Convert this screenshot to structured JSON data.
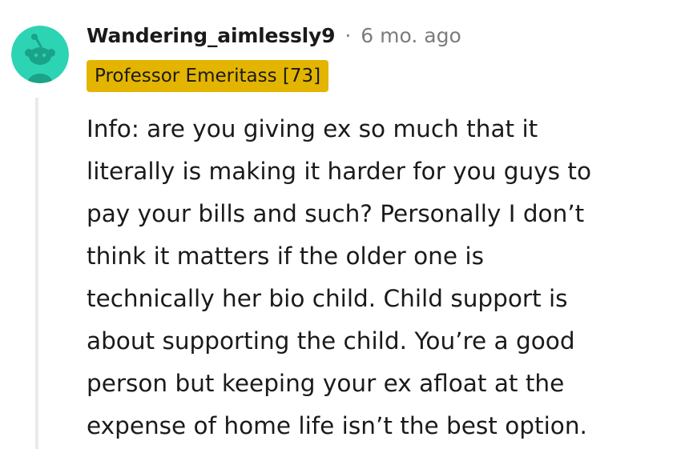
{
  "comment": {
    "author": "Wandering_aimlessly9",
    "separator": "·",
    "timestamp": "6 mo. ago",
    "flair": "Professor Emeritass [73]",
    "avatar_icon": "snoo-avatar-icon",
    "colors": {
      "avatar_background": "#2dd4b4",
      "avatar_figure": "#1aa389",
      "flair_background": "#e3b500",
      "meta_text": "#7c7c7c",
      "body_text": "#1a1a1b",
      "thread_line": "#eaeaea"
    },
    "body_lines": [
      "Info: are you giving ex so much that it",
      "literally is making it harder for you guys to",
      "pay your bills and such? Personally I don’t",
      "think it matters if the older one is",
      "technically her bio child. Child support is",
      "about supporting the child. You’re a good",
      "person but keeping your ex afloat at the",
      "expense of home life isn’t the best option."
    ]
  }
}
